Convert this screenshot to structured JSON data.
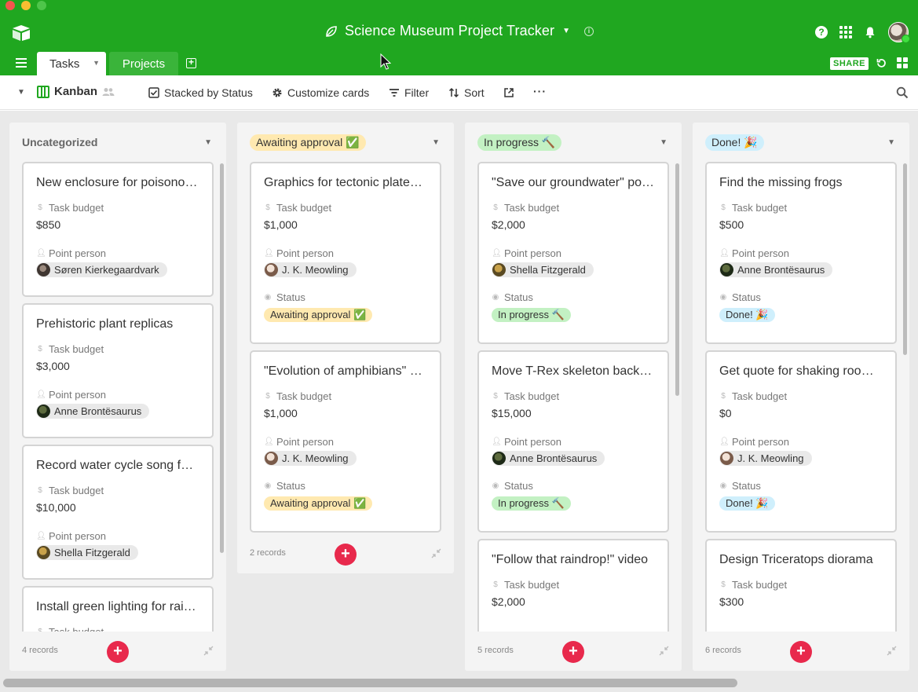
{
  "app": {
    "title": "Science Museum Project Tracker",
    "tabs": [
      {
        "label": "Tasks",
        "active": true
      },
      {
        "label": "Projects",
        "active": false
      }
    ],
    "share_label": "SHARE"
  },
  "toolbar": {
    "view_name": "Kanban",
    "stacked_label": "Stacked by Status",
    "customize_label": "Customize cards",
    "filter_label": "Filter",
    "sort_label": "Sort",
    "more_label": "···"
  },
  "colors": {
    "brand_green": "#20a720",
    "add_red": "#e8294c",
    "awaiting": "#ffe9b0",
    "in_progress": "#c3f1c3",
    "done": "#cfeffc"
  },
  "labels": {
    "task_budget": "Task budget",
    "point_person": "Point person",
    "status": "Status"
  },
  "columns": [
    {
      "title": "Uncategorized",
      "records": "4 records",
      "cards": [
        {
          "title": "New enclosure for poisonous frogs",
          "budget": "$850",
          "person": "Søren Kierkegaardvark"
        },
        {
          "title": "Prehistoric plant replicas",
          "budget": "$3,000",
          "person": "Anne Brontësaurus"
        },
        {
          "title": "Record water cycle song for exhibit",
          "budget": "$10,000",
          "person": "Shella Fitzgerald"
        },
        {
          "title": "Install green lighting for rainforest",
          "budget": "",
          "person": ""
        }
      ]
    },
    {
      "title": "Awaiting approval ✅",
      "records": "2 records",
      "cards": [
        {
          "title": "Graphics for tectonic plates exhibit",
          "budget": "$1,000",
          "person": "J. K. Meowling",
          "status": "Awaiting approval ✅"
        },
        {
          "title": "\"Evolution of amphibians\" video",
          "budget": "$1,000",
          "person": "J. K. Meowling",
          "status": "Awaiting approval ✅"
        }
      ]
    },
    {
      "title": "In progress 🔨",
      "records": "5 records",
      "cards": [
        {
          "title": "\"Save our groundwater\" poster",
          "budget": "$2,000",
          "person": "Shella Fitzgerald",
          "status": "In progress 🔨"
        },
        {
          "title": "Move T-Rex skeleton back to lobby",
          "budget": "$15,000",
          "person": "Anne Brontësaurus",
          "status": "In progress 🔨"
        },
        {
          "title": "\"Follow that raindrop!\" video",
          "budget": "$2,000",
          "person": "",
          "status": ""
        }
      ]
    },
    {
      "title": "Done! 🎉",
      "records": "6 records",
      "cards": [
        {
          "title": "Find the missing frogs",
          "budget": "$500",
          "person": "Anne Brontësaurus",
          "status": "Done! 🎉"
        },
        {
          "title": "Get quote for shaking room floor",
          "budget": "$0",
          "person": "J. K. Meowling",
          "status": "Done! 🎉"
        },
        {
          "title": "Design Triceratops diorama",
          "budget": "$300",
          "person": "",
          "status": ""
        }
      ]
    }
  ]
}
